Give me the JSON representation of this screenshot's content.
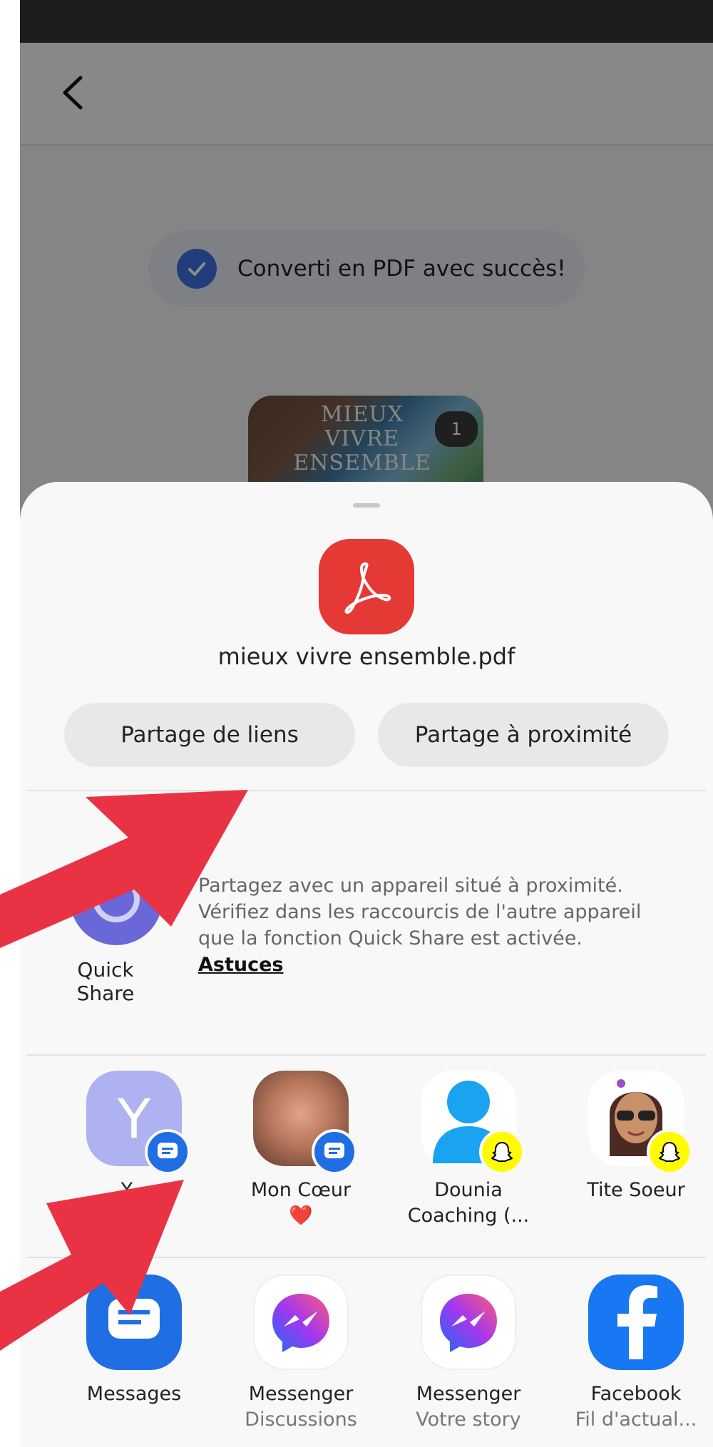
{
  "toast": {
    "text": "Converti en PDF avec succès!"
  },
  "document_thumb": {
    "title_line1": "MIEUX VIVRE",
    "title_line2": "ENSEMBLE",
    "page_count": "1"
  },
  "share_sheet": {
    "filename": "mieux vivre ensemble.pdf",
    "buttons": {
      "link_share": "Partage de liens",
      "nearby_share": "Partage à proximité"
    },
    "quick_share": {
      "label": "Quick Share",
      "description": "Partagez avec un appareil situé à proximité. Vérifiez dans les raccourcis de l'autre appareil que la fonction Quick Share est activée.",
      "link": "Astuces"
    },
    "contacts": [
      {
        "name": "Y...",
        "initial": "Y",
        "badge": "messages"
      },
      {
        "name": "Mon Cœur",
        "emoji": "❤️",
        "badge": "messages"
      },
      {
        "name": "Dounia",
        "name2": "Coaching (...",
        "badge": "snapchat"
      },
      {
        "name": "Tite Soeur",
        "badge": "snapchat"
      }
    ],
    "apps": [
      {
        "label": "Messages",
        "sub": ""
      },
      {
        "label": "Messenger",
        "sub": "Discussions"
      },
      {
        "label": "Messenger",
        "sub": "Votre story"
      },
      {
        "label": "Facebook",
        "sub": "Fil d'actual..."
      }
    ]
  },
  "colors": {
    "arrow": "#e93344",
    "pdf_red": "#e53935",
    "messages_blue": "#1f6ee3",
    "snap_yellow": "#fffc00",
    "facebook_blue": "#1877f2"
  }
}
